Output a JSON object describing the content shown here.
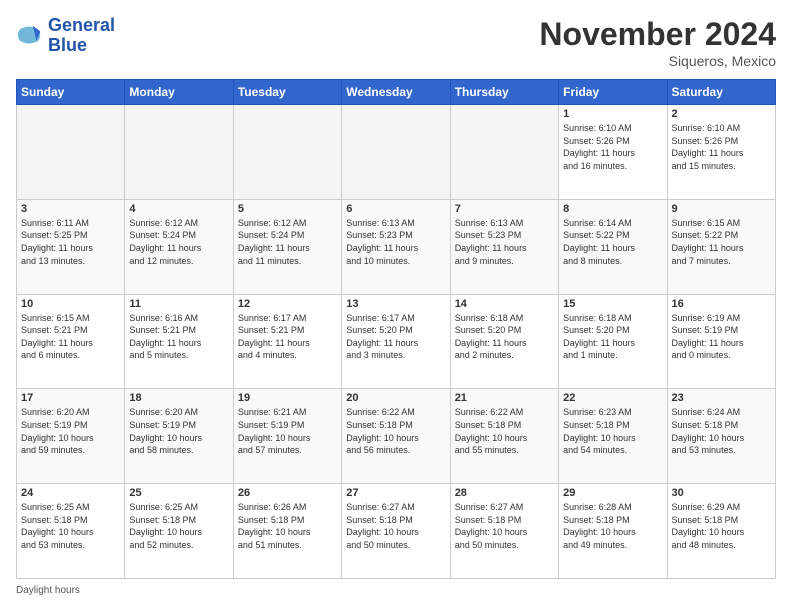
{
  "logo": {
    "line1": "General",
    "line2": "Blue"
  },
  "title": "November 2024",
  "location": "Siqueros, Mexico",
  "days": [
    "Sunday",
    "Monday",
    "Tuesday",
    "Wednesday",
    "Thursday",
    "Friday",
    "Saturday"
  ],
  "weeks": [
    [
      {
        "num": "",
        "info": "",
        "empty": true
      },
      {
        "num": "",
        "info": "",
        "empty": true
      },
      {
        "num": "",
        "info": "",
        "empty": true
      },
      {
        "num": "",
        "info": "",
        "empty": true
      },
      {
        "num": "",
        "info": "",
        "empty": true
      },
      {
        "num": "1",
        "info": "Sunrise: 6:10 AM\nSunset: 5:26 PM\nDaylight: 11 hours\nand 16 minutes."
      },
      {
        "num": "2",
        "info": "Sunrise: 6:10 AM\nSunset: 5:26 PM\nDaylight: 11 hours\nand 15 minutes."
      }
    ],
    [
      {
        "num": "3",
        "info": "Sunrise: 6:11 AM\nSunset: 5:25 PM\nDaylight: 11 hours\nand 13 minutes."
      },
      {
        "num": "4",
        "info": "Sunrise: 6:12 AM\nSunset: 5:24 PM\nDaylight: 11 hours\nand 12 minutes."
      },
      {
        "num": "5",
        "info": "Sunrise: 6:12 AM\nSunset: 5:24 PM\nDaylight: 11 hours\nand 11 minutes."
      },
      {
        "num": "6",
        "info": "Sunrise: 6:13 AM\nSunset: 5:23 PM\nDaylight: 11 hours\nand 10 minutes."
      },
      {
        "num": "7",
        "info": "Sunrise: 6:13 AM\nSunset: 5:23 PM\nDaylight: 11 hours\nand 9 minutes."
      },
      {
        "num": "8",
        "info": "Sunrise: 6:14 AM\nSunset: 5:22 PM\nDaylight: 11 hours\nand 8 minutes."
      },
      {
        "num": "9",
        "info": "Sunrise: 6:15 AM\nSunset: 5:22 PM\nDaylight: 11 hours\nand 7 minutes."
      }
    ],
    [
      {
        "num": "10",
        "info": "Sunrise: 6:15 AM\nSunset: 5:21 PM\nDaylight: 11 hours\nand 6 minutes."
      },
      {
        "num": "11",
        "info": "Sunrise: 6:16 AM\nSunset: 5:21 PM\nDaylight: 11 hours\nand 5 minutes."
      },
      {
        "num": "12",
        "info": "Sunrise: 6:17 AM\nSunset: 5:21 PM\nDaylight: 11 hours\nand 4 minutes."
      },
      {
        "num": "13",
        "info": "Sunrise: 6:17 AM\nSunset: 5:20 PM\nDaylight: 11 hours\nand 3 minutes."
      },
      {
        "num": "14",
        "info": "Sunrise: 6:18 AM\nSunset: 5:20 PM\nDaylight: 11 hours\nand 2 minutes."
      },
      {
        "num": "15",
        "info": "Sunrise: 6:18 AM\nSunset: 5:20 PM\nDaylight: 11 hours\nand 1 minute."
      },
      {
        "num": "16",
        "info": "Sunrise: 6:19 AM\nSunset: 5:19 PM\nDaylight: 11 hours\nand 0 minutes."
      }
    ],
    [
      {
        "num": "17",
        "info": "Sunrise: 6:20 AM\nSunset: 5:19 PM\nDaylight: 10 hours\nand 59 minutes."
      },
      {
        "num": "18",
        "info": "Sunrise: 6:20 AM\nSunset: 5:19 PM\nDaylight: 10 hours\nand 58 minutes."
      },
      {
        "num": "19",
        "info": "Sunrise: 6:21 AM\nSunset: 5:19 PM\nDaylight: 10 hours\nand 57 minutes."
      },
      {
        "num": "20",
        "info": "Sunrise: 6:22 AM\nSunset: 5:18 PM\nDaylight: 10 hours\nand 56 minutes."
      },
      {
        "num": "21",
        "info": "Sunrise: 6:22 AM\nSunset: 5:18 PM\nDaylight: 10 hours\nand 55 minutes."
      },
      {
        "num": "22",
        "info": "Sunrise: 6:23 AM\nSunset: 5:18 PM\nDaylight: 10 hours\nand 54 minutes."
      },
      {
        "num": "23",
        "info": "Sunrise: 6:24 AM\nSunset: 5:18 PM\nDaylight: 10 hours\nand 53 minutes."
      }
    ],
    [
      {
        "num": "24",
        "info": "Sunrise: 6:25 AM\nSunset: 5:18 PM\nDaylight: 10 hours\nand 53 minutes."
      },
      {
        "num": "25",
        "info": "Sunrise: 6:25 AM\nSunset: 5:18 PM\nDaylight: 10 hours\nand 52 minutes."
      },
      {
        "num": "26",
        "info": "Sunrise: 6:26 AM\nSunset: 5:18 PM\nDaylight: 10 hours\nand 51 minutes."
      },
      {
        "num": "27",
        "info": "Sunrise: 6:27 AM\nSunset: 5:18 PM\nDaylight: 10 hours\nand 50 minutes."
      },
      {
        "num": "28",
        "info": "Sunrise: 6:27 AM\nSunset: 5:18 PM\nDaylight: 10 hours\nand 50 minutes."
      },
      {
        "num": "29",
        "info": "Sunrise: 6:28 AM\nSunset: 5:18 PM\nDaylight: 10 hours\nand 49 minutes."
      },
      {
        "num": "30",
        "info": "Sunrise: 6:29 AM\nSunset: 5:18 PM\nDaylight: 10 hours\nand 48 minutes."
      }
    ]
  ],
  "footer": "Daylight hours"
}
